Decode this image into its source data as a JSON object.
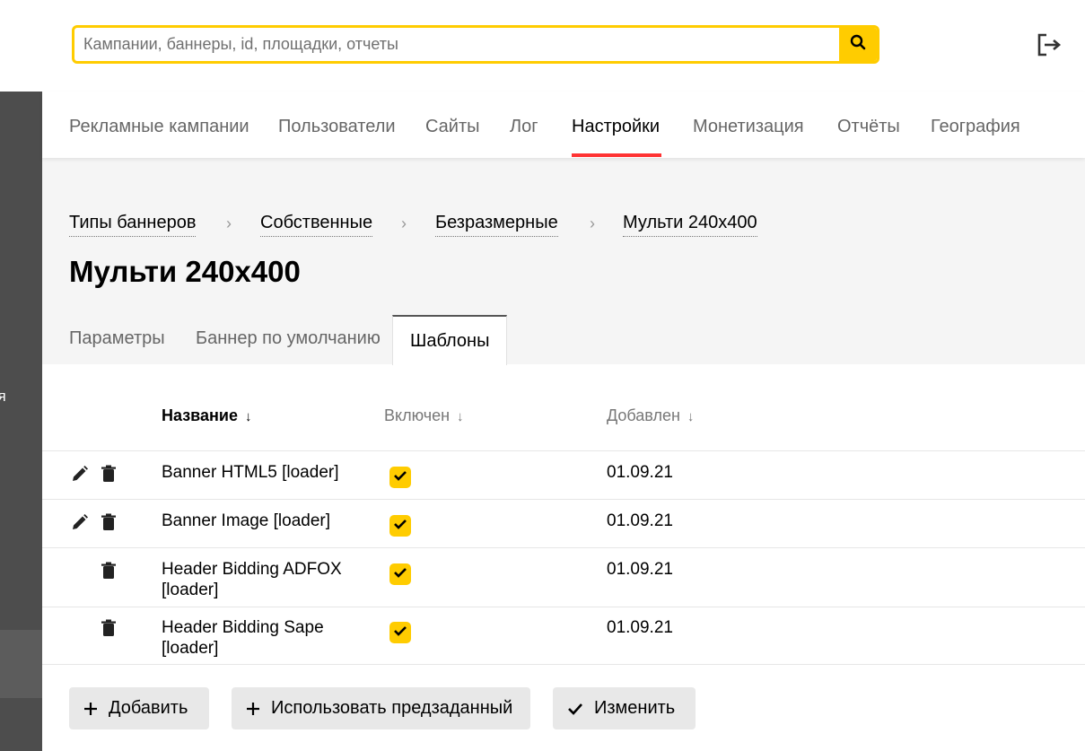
{
  "search": {
    "placeholder": "Кампании, баннеры, id, площадки, отчеты",
    "icon": "search-icon"
  },
  "header": {
    "logout_icon": "logout-icon"
  },
  "sidebar": {
    "partial_label": "ия"
  },
  "nav": {
    "items": [
      {
        "label": "Рекламные кампании"
      },
      {
        "label": "Пользователи"
      },
      {
        "label": "Сайты"
      },
      {
        "label": "Лог"
      },
      {
        "label": "Настройки",
        "active": true
      },
      {
        "label": "Монетизация"
      },
      {
        "label": "Отчёты"
      },
      {
        "label": "География"
      }
    ],
    "active_color": "#ff3333"
  },
  "breadcrumb": {
    "items": [
      "Типы баннеров",
      "Собственные",
      "Безразмерные",
      "Мульти 240x400"
    ],
    "separator": "›"
  },
  "page": {
    "title": "Мульти 240x400"
  },
  "tabs": {
    "items": [
      {
        "label": "Параметры"
      },
      {
        "label": "Баннер по умолчанию"
      },
      {
        "label": "Шаблоны",
        "active": true
      }
    ]
  },
  "table": {
    "columns": [
      {
        "label": "Название",
        "sort": "↓"
      },
      {
        "label": "Включен",
        "sort": "↓"
      },
      {
        "label": "Добавлен",
        "sort": "↓"
      }
    ],
    "rows": [
      {
        "name_line1": "Banner HTML5 [loader]",
        "name_line2": "",
        "enabled": true,
        "added": "01.09.21",
        "editable": true
      },
      {
        "name_line1": "Banner Image [loader]",
        "name_line2": "",
        "enabled": true,
        "added": "01.09.21",
        "editable": true
      },
      {
        "name_line1": "Header Bidding ADFOX",
        "name_line2": "[loader]",
        "enabled": true,
        "added": "01.09.21",
        "editable": false
      },
      {
        "name_line1": "Header Bidding Sape",
        "name_line2": "[loader]",
        "enabled": true,
        "added": "01.09.21",
        "editable": false
      }
    ]
  },
  "actions": {
    "add_label": "Добавить",
    "use_preset_label": "Использовать предзаданный",
    "edit_label": "Изменить"
  },
  "colors": {
    "accent": "#ffcc00",
    "sidebar": "#4d4d4d",
    "gray_bg": "#f5f5f5"
  }
}
